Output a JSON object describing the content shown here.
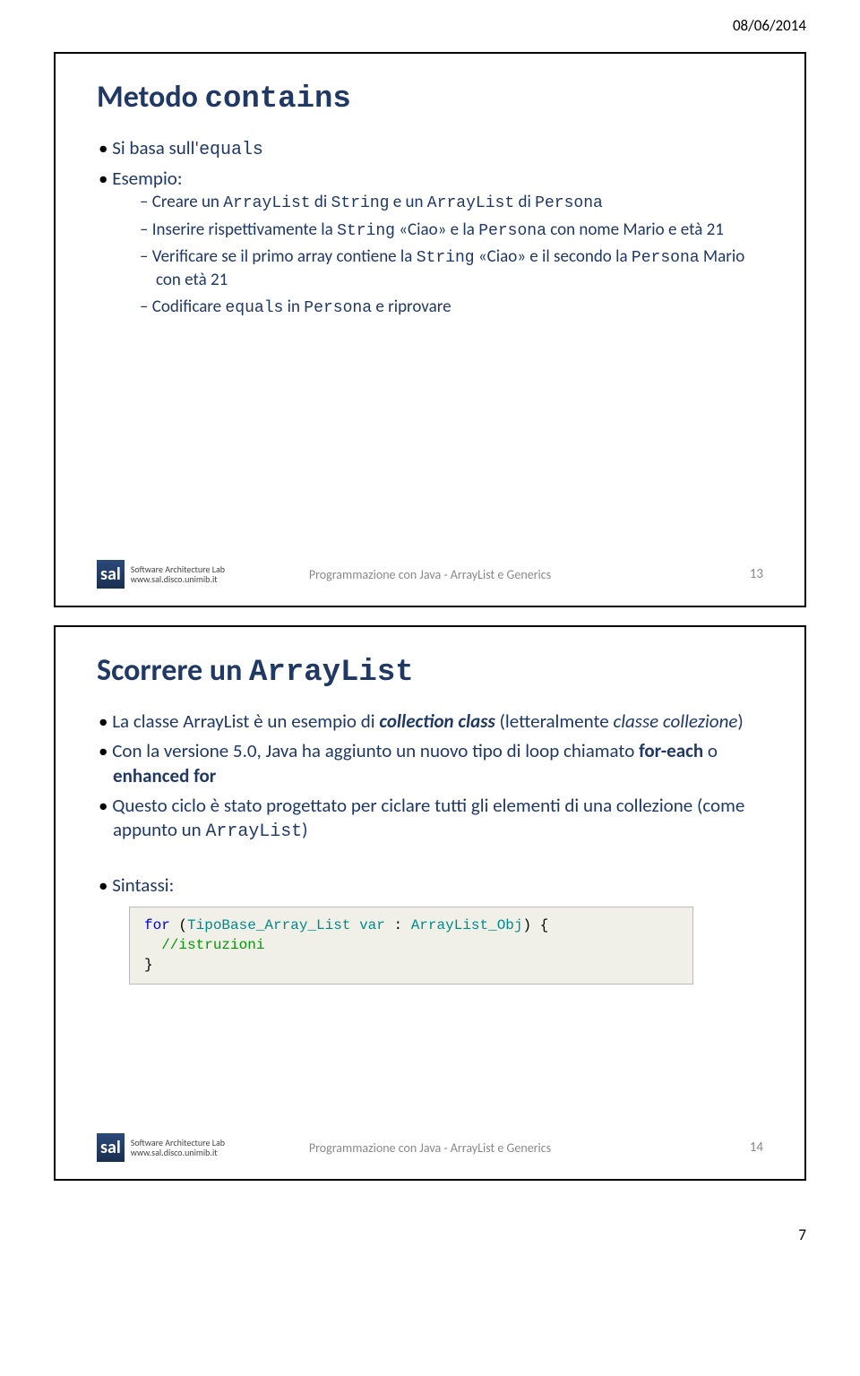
{
  "header_date": "08/06/2014",
  "page_number": "7",
  "footer": {
    "lab_name": "Software Architecture Lab",
    "lab_url": "www.sal.disco.unimib.it",
    "center_text": "Programmazione con Java - ArrayList e Generics",
    "logo_text": "sal"
  },
  "slide1": {
    "title_prefix": "Metodo ",
    "title_mono": "contains",
    "bullets": [
      {
        "parts": [
          "Si basa sull'",
          {
            "mono": "equals"
          }
        ]
      },
      {
        "parts": [
          "Esempio:"
        ]
      }
    ],
    "sub": [
      {
        "parts": [
          "Creare un ",
          {
            "mono": "ArrayList"
          },
          " di ",
          {
            "mono": "String"
          },
          " e un ",
          {
            "mono": "ArrayList"
          },
          " di ",
          {
            "mono": "Persona"
          }
        ]
      },
      {
        "parts": [
          "Inserire rispettivamente la ",
          {
            "mono": "String"
          },
          " «Ciao» e la ",
          {
            "mono": "Persona"
          },
          " con nome Mario e età 21"
        ]
      },
      {
        "parts": [
          "Verificare se il primo array contiene la ",
          {
            "mono": "String"
          },
          " «Ciao» e il secondo la ",
          {
            "mono": "Persona"
          },
          " Mario con età 21"
        ]
      },
      {
        "parts": [
          "Codificare ",
          {
            "mono": "equals"
          },
          " in ",
          {
            "mono": "Persona"
          },
          " e riprovare"
        ]
      }
    ],
    "slide_num": "13"
  },
  "slide2": {
    "title_prefix": "Scorrere un ",
    "title_mono": "ArrayList",
    "bullets": [
      {
        "parts": [
          "La classe ArrayList è un esempio di ",
          {
            "bi": "collection class"
          },
          " (letteralmente ",
          {
            "i": "classe collezione"
          },
          ")"
        ]
      },
      {
        "parts": [
          "Con la versione 5.0, Java ha aggiunto un nuovo tipo di loop chiamato ",
          {
            "b": "for-each"
          },
          " o ",
          {
            "b": "enhanced for"
          }
        ]
      },
      {
        "parts": [
          "Questo ciclo è stato progettato per ciclare tutti gli elementi di una collezione (come appunto un ",
          {
            "mono": "ArrayList"
          },
          ")"
        ]
      }
    ],
    "syntax_label": "Sintassi:",
    "code": {
      "k_for": "for",
      "tbase": "TipoBase_Array_List",
      "var": "var",
      "obj": "ArrayList_Obj",
      "comment": "//istruzioni"
    },
    "slide_num": "14"
  }
}
